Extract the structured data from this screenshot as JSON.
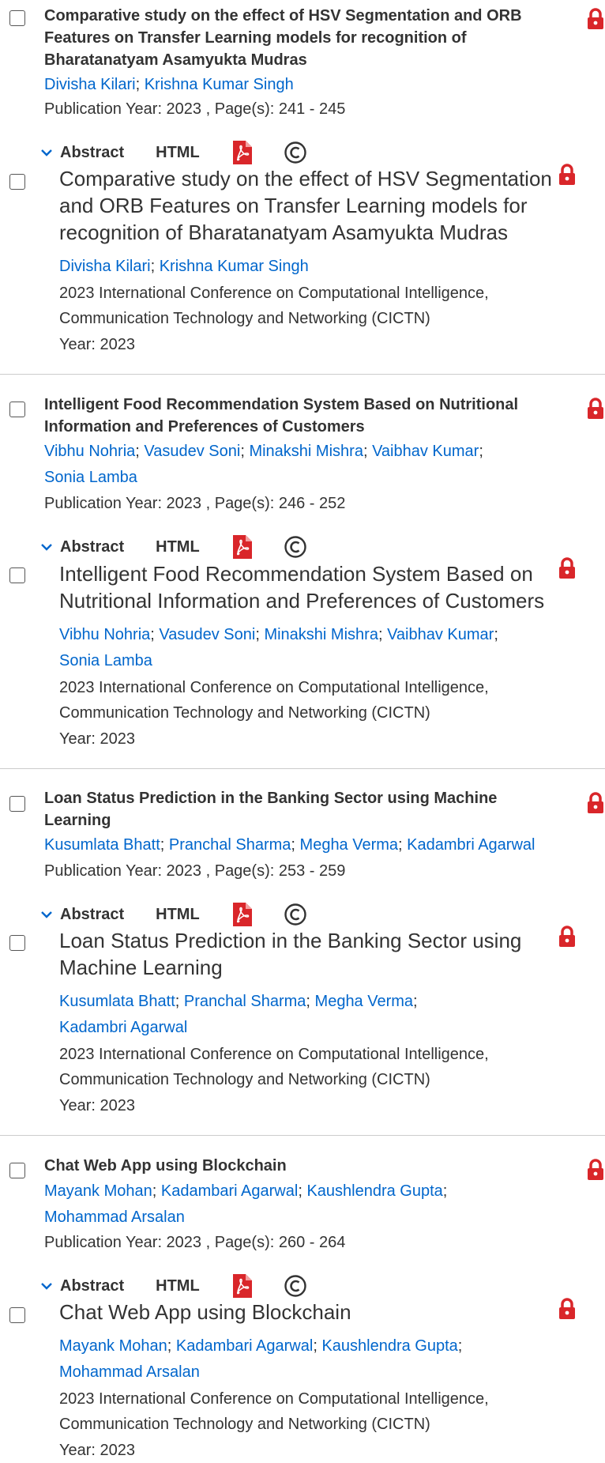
{
  "colors": {
    "link": "#0066cc",
    "lock": "#d9262a",
    "pdf": "#d9262a",
    "divider": "#cccccc"
  },
  "icons": {
    "lock": "lock-icon",
    "pdf": "pdf-icon",
    "copyright": "copyright-icon",
    "chevron": "chevron-down-icon",
    "checkbox": "checkbox"
  },
  "labels": {
    "abstract": "Abstract",
    "html": "HTML",
    "year_prefix": "Year: 2023"
  },
  "items": [
    {
      "title": "Comparative study on the effect of HSV Segmentation and ORB Features on Transfer Learning models for recognition of Bharatanatyam Asamyukta Mudras",
      "authors": [
        "Divisha Kilari",
        "Krishna Kumar Singh"
      ],
      "pub_info": "Publication Year: 2023 , Page(s): 241  -  245",
      "large_title": "Comparative study on the effect of HSV Segmentation and ORB Features on Transfer Learning models for recognition of Bharatanatyam Asamyukta Mudras",
      "conference": "2023 International Conference on Computational Intelligence, Communication Technology and Networking (CICTN)",
      "year": "Year: 2023"
    },
    {
      "title": "Intelligent Food Recommendation System Based on Nutritional Information and Preferences of Customers",
      "authors": [
        "Vibhu Nohria",
        "Vasudev Soni",
        "Minakshi Mishra",
        "Vaibhav Kumar",
        "Sonia Lamba"
      ],
      "pub_info": "Publication Year: 2023 , Page(s): 246  -  252",
      "large_title": "Intelligent Food Recommendation System Based on Nutritional Information and Preferences of Customers",
      "conference": "2023 International Conference on Computational Intelligence, Communication Technology and Networking (CICTN)",
      "year": "Year: 2023"
    },
    {
      "title": "Loan Status Prediction in the Banking Sector using Machine Learning",
      "authors": [
        "Kusumlata Bhatt",
        "Pranchal Sharma",
        "Megha Verma",
        "Kadambri Agarwal"
      ],
      "pub_info": "Publication Year: 2023 , Page(s): 253  -  259",
      "large_title": "Loan Status Prediction in the Banking Sector using Machine Learning",
      "conference": "2023 International Conference on Computational Intelligence, Communication Technology and Networking (CICTN)",
      "year": "Year: 2023"
    },
    {
      "title": "Chat Web App using Blockchain",
      "authors": [
        "Mayank Mohan",
        "Kadambari Agarwal",
        "Kaushlendra Gupta",
        "Mohammad Arsalan"
      ],
      "pub_info": "Publication Year: 2023 , Page(s): 260  -  264",
      "large_title": "Chat Web App using Blockchain",
      "conference": "2023 International Conference on Computational Intelligence, Communication Technology and Networking (CICTN)",
      "year": "Year: 2023"
    }
  ]
}
